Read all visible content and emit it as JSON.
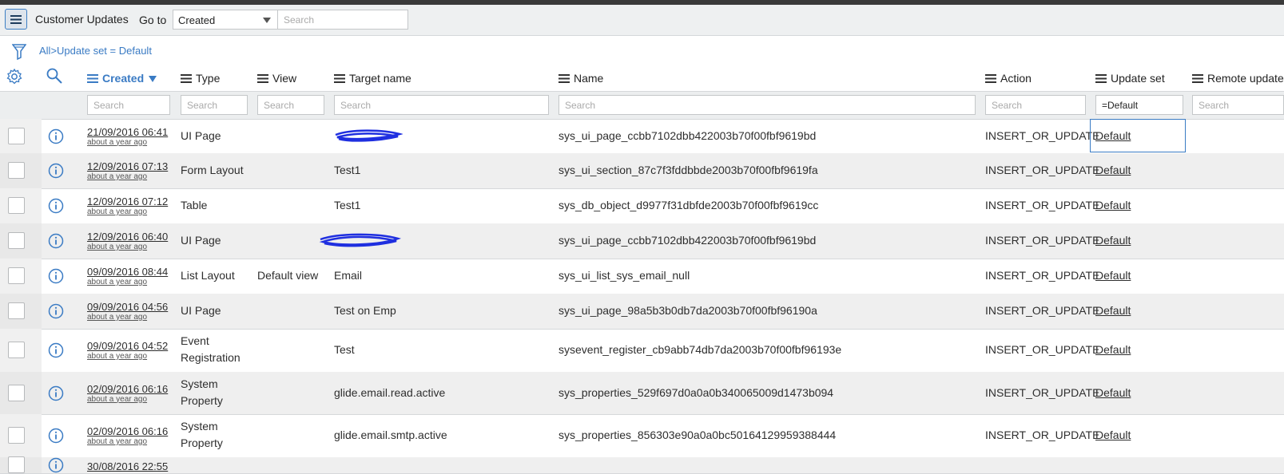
{
  "header": {
    "title": "Customer Updates",
    "goto_label": "Go to",
    "goto_field": "Created",
    "search_placeholder": "Search"
  },
  "breadcrumb": {
    "all": "All",
    "separator": ">",
    "filter": "Update set = Default"
  },
  "columns": [
    {
      "key": "created",
      "label": "Created",
      "sorted": true
    },
    {
      "key": "type",
      "label": "Type"
    },
    {
      "key": "view",
      "label": "View"
    },
    {
      "key": "target",
      "label": "Target name"
    },
    {
      "key": "name",
      "label": "Name"
    },
    {
      "key": "action",
      "label": "Action"
    },
    {
      "key": "update_set",
      "label": "Update set"
    },
    {
      "key": "remote",
      "label": "Remote update"
    }
  ],
  "column_search": {
    "placeholder": "Search",
    "update_set_value": "=Default"
  },
  "rows": [
    {
      "date": "21/09/2016 06:41",
      "ago": "about a year ago",
      "type": "UI Page",
      "type2": "",
      "view": "",
      "target": "",
      "name": "sys_ui_page_ccbb7102dbb422003b70f00fbf9619bd",
      "action": "INSERT_OR_UPDATE",
      "update_set": "Default"
    },
    {
      "date": "12/09/2016 07:13",
      "ago": "about a year ago",
      "type": "Form Layout",
      "type2": "",
      "view": "",
      "target": "Test1",
      "name": "sys_ui_section_87c7f3fddbbde2003b70f00fbf9619fa",
      "action": "INSERT_OR_UPDATE",
      "update_set": "Default"
    },
    {
      "date": "12/09/2016 07:12",
      "ago": "about a year ago",
      "type": "Table",
      "type2": "",
      "view": "",
      "target": "Test1",
      "name": "sys_db_object_d9977f31dbfde2003b70f00fbf9619cc",
      "action": "INSERT_OR_UPDATE",
      "update_set": "Default"
    },
    {
      "date": "12/09/2016 06:40",
      "ago": "about a year ago",
      "type": "UI Page",
      "type2": "",
      "view": "",
      "target": "",
      "name": "sys_ui_page_ccbb7102dbb422003b70f00fbf9619bd",
      "action": "INSERT_OR_UPDATE",
      "update_set": "Default"
    },
    {
      "date": "09/09/2016 08:44",
      "ago": "about a year ago",
      "type": "List Layout",
      "type2": "",
      "view": "Default view",
      "target": "Email",
      "name": "sys_ui_list_sys_email_null",
      "action": "INSERT_OR_UPDATE",
      "update_set": "Default"
    },
    {
      "date": "09/09/2016 04:56",
      "ago": "about a year ago",
      "type": "UI Page",
      "type2": "",
      "view": "",
      "target": "Test on Emp",
      "name": "sys_ui_page_98a5b3b0db7da2003b70f00fbf96190a",
      "action": "INSERT_OR_UPDATE",
      "update_set": "Default"
    },
    {
      "date": "09/09/2016 04:52",
      "ago": "about a year ago",
      "type": "Event",
      "type2": "Registration",
      "view": "",
      "target": "Test",
      "name": "sysevent_register_cb9abb74db7da2003b70f00fbf96193e",
      "action": "INSERT_OR_UPDATE",
      "update_set": "Default"
    },
    {
      "date": "02/09/2016 06:16",
      "ago": "about a year ago",
      "type": "System",
      "type2": "Property",
      "view": "",
      "target": "glide.email.read.active",
      "name": "sys_properties_529f697d0a0a0b340065009d1473b094",
      "action": "INSERT_OR_UPDATE",
      "update_set": "Default"
    },
    {
      "date": "02/09/2016 06:16",
      "ago": "about a year ago",
      "type": "System",
      "type2": "Property",
      "view": "",
      "target": "glide.email.smtp.active",
      "name": "sys_properties_856303e90a0a0bc50164129959388444",
      "action": "INSERT_OR_UPDATE",
      "update_set": "Default"
    },
    {
      "date": "30/08/2016 22:55",
      "ago": "",
      "type": "",
      "type2": "",
      "view": "",
      "target": "",
      "name": "",
      "action": "",
      "update_set": ""
    }
  ],
  "colors": {
    "accent": "#3a7bc4",
    "header_bg": "#eef0f1",
    "scribble": "#1f2fe0"
  },
  "icons": {
    "menu": "hamburger-menu-icon",
    "filter": "funnel-icon",
    "settings": "gear-icon",
    "search": "magnifier-icon",
    "info": "info-circle-icon",
    "column_menu": "column-lines-icon"
  }
}
